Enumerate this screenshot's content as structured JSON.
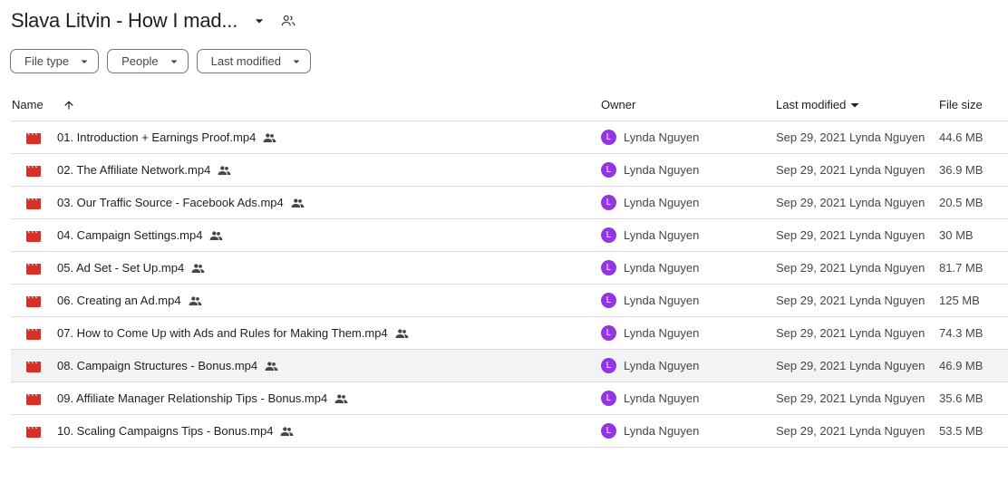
{
  "header": {
    "title": "Slava Litvin - How I mad...",
    "caret_icon": "arrow-drop-down-icon",
    "share_icon": "people-outline-icon"
  },
  "filters": [
    {
      "label": "File type"
    },
    {
      "label": "People"
    },
    {
      "label": "Last modified"
    }
  ],
  "table": {
    "columns": {
      "name": "Name",
      "owner": "Owner",
      "modified": "Last modified",
      "size": "File size"
    },
    "rows": [
      {
        "name": "01. Introduction + Earnings Proof.mp4",
        "owner": "Lynda Nguyen",
        "avatar": "L",
        "modified": "Sep 29, 2021 Lynda Nguyen",
        "size": "44.6 MB"
      },
      {
        "name": "02. The Affiliate Network.mp4",
        "owner": "Lynda Nguyen",
        "avatar": "L",
        "modified": "Sep 29, 2021 Lynda Nguyen",
        "size": "36.9 MB"
      },
      {
        "name": "03. Our Traffic Source - Facebook Ads.mp4",
        "owner": "Lynda Nguyen",
        "avatar": "L",
        "modified": "Sep 29, 2021 Lynda Nguyen",
        "size": "20.5 MB"
      },
      {
        "name": "04. Campaign Settings.mp4",
        "owner": "Lynda Nguyen",
        "avatar": "L",
        "modified": "Sep 29, 2021 Lynda Nguyen",
        "size": "30 MB"
      },
      {
        "name": "05. Ad Set - Set Up.mp4",
        "owner": "Lynda Nguyen",
        "avatar": "L",
        "modified": "Sep 29, 2021 Lynda Nguyen",
        "size": "81.7 MB"
      },
      {
        "name": "06. Creating an Ad.mp4",
        "owner": "Lynda Nguyen",
        "avatar": "L",
        "modified": "Sep 29, 2021 Lynda Nguyen",
        "size": "125 MB"
      },
      {
        "name": "07. How to Come Up with Ads and Rules for Making Them.mp4",
        "owner": "Lynda Nguyen",
        "avatar": "L",
        "modified": "Sep 29, 2021 Lynda Nguyen",
        "size": "74.3 MB"
      },
      {
        "name": "08. Campaign Structures - Bonus.mp4",
        "owner": "Lynda Nguyen",
        "avatar": "L",
        "modified": "Sep 29, 2021 Lynda Nguyen",
        "size": "46.9 MB",
        "hover": true
      },
      {
        "name": "09. Affiliate Manager Relationship Tips - Bonus.mp4",
        "owner": "Lynda Nguyen",
        "avatar": "L",
        "modified": "Sep 29, 2021 Lynda Nguyen",
        "size": "35.6 MB"
      },
      {
        "name": "10. Scaling Campaigns Tips - Bonus.mp4",
        "owner": "Lynda Nguyen",
        "avatar": "L",
        "modified": "Sep 29, 2021 Lynda Nguyen",
        "size": "53.5 MB"
      }
    ]
  },
  "icons": {
    "file": "video-file-icon",
    "shared": "shared-people-icon",
    "sort": "arrow-upward-icon",
    "modified_caret": "arrow-drop-down-icon"
  },
  "colors": {
    "video_icon": "#d93025",
    "avatar_bg": "#9334e6",
    "hover_row": "#f1f3f4",
    "divider": "#dadce0"
  }
}
